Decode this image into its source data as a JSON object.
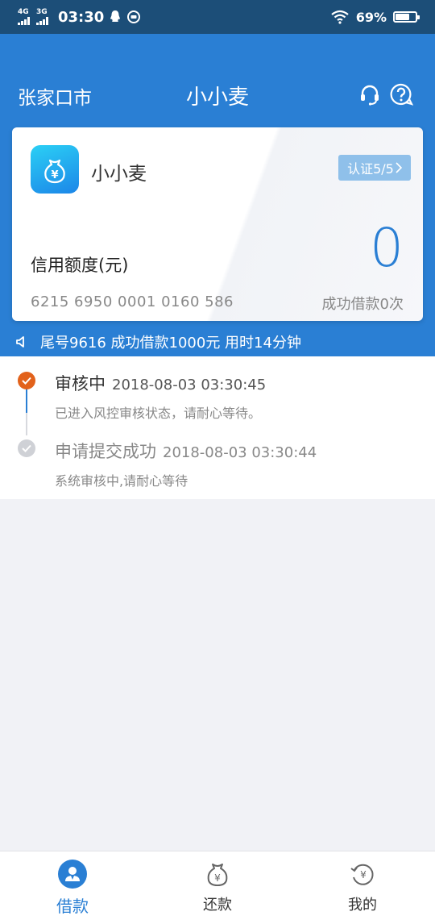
{
  "status_bar": {
    "net1": "4G",
    "net2": "3G",
    "time": "03:30",
    "battery_pct": "69%",
    "battery_level": 0.69
  },
  "header": {
    "city": "张家口市",
    "title": "小小麦",
    "icons": [
      "headset-icon",
      "help-icon"
    ]
  },
  "card": {
    "app_name": "小小麦",
    "verify_badge": "认证5/5",
    "credit_label": "信用额度(元)",
    "credit_amount": "0",
    "card_number": "6215 6950 0001 0160 586",
    "loan_count": "成功借款0次"
  },
  "notice": {
    "text": "尾号9616 成功借款1000元 用时14分钟"
  },
  "timeline": [
    {
      "title": "审核中",
      "time": "2018-08-03 03:30:45",
      "desc": "已进入风控审核状态，请耐心等待。",
      "state": "active"
    },
    {
      "title": "申请提交成功",
      "time": "2018-08-03 03:30:44",
      "desc": "系统审核中,请耐心等待",
      "state": "done"
    }
  ],
  "tabbar": {
    "items": [
      {
        "label": "借款",
        "icon": "borrow-icon",
        "active": true
      },
      {
        "label": "还款",
        "icon": "money-bag-icon",
        "active": false
      },
      {
        "label": "我的",
        "icon": "history-yuan-icon",
        "active": false
      }
    ]
  },
  "colors": {
    "brand": "#2a7fd4",
    "status_bar": "#1c4e78",
    "active_dot": "#e2621b"
  }
}
